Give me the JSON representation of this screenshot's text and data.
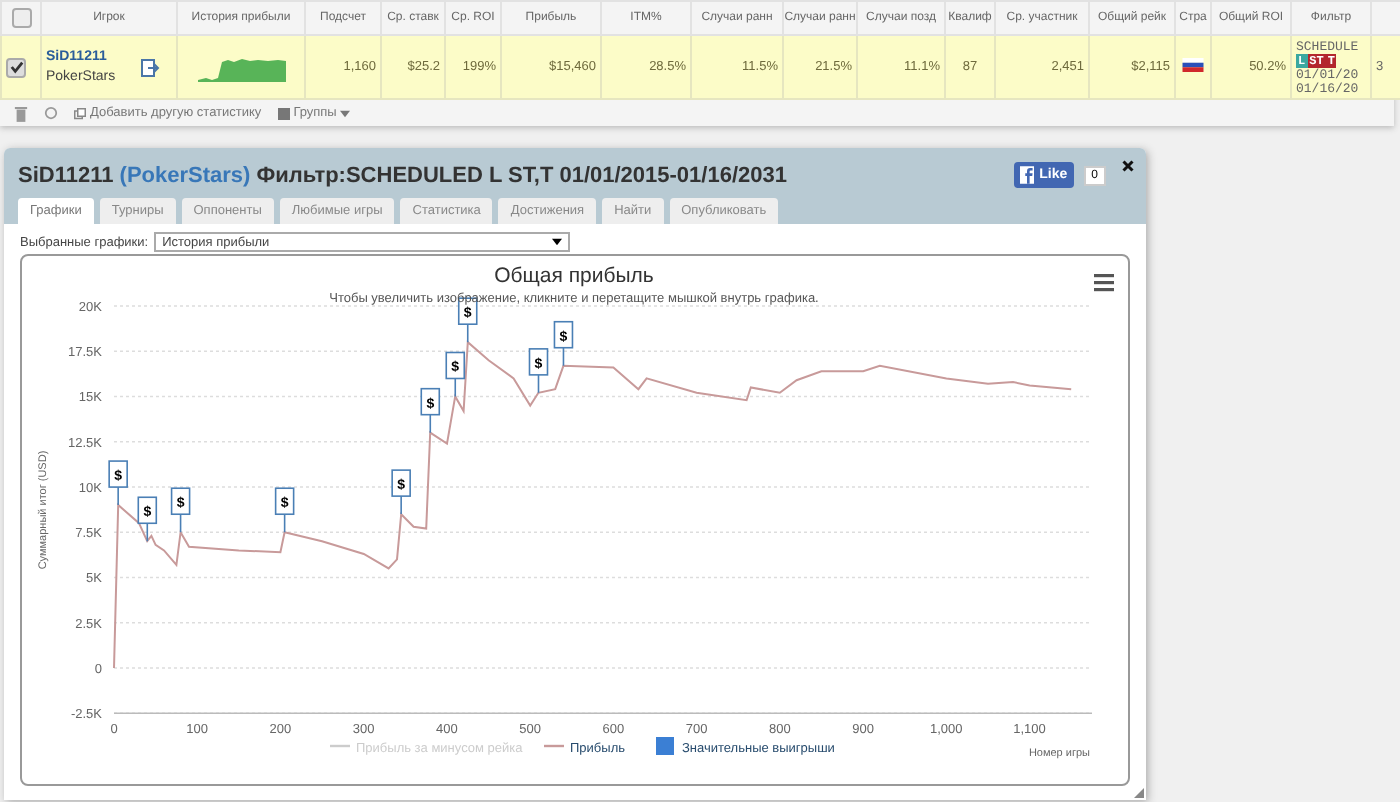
{
  "table": {
    "header_checked": false,
    "columns": [
      "Игрок",
      "История прибыли",
      "Подсчет",
      "Ср. ставк",
      "Ср. ROI",
      "Прибыль",
      "ITM%",
      "Случаи ранн",
      "Случаи ранн",
      "Случаи позд",
      "Квалиф",
      "Ср. участник",
      "Общий рейк",
      "Стра",
      "Общий ROI",
      "Фильтр"
    ],
    "rows": [
      {
        "checked": true,
        "player": "SiD11211",
        "site": "PokerStars",
        "values": [
          "1,160",
          "$25.2",
          "199%",
          "$15,460",
          "28.5%",
          "11.5%",
          "21.5%",
          "11.1%",
          "87",
          "2,451",
          "$2,115"
        ],
        "roi_total": "50.2%",
        "filter": {
          "text": "SCHEDULE",
          "badges": [
            {
              "label": "L",
              "color": "#3aa8a0"
            },
            {
              "label": "ST",
              "color": "#b3262d"
            },
            {
              "label": "T",
              "color": "#b3262d"
            }
          ],
          "dates": [
            "01/01/20",
            "01/16/20"
          ]
        },
        "column_18": "3"
      }
    ]
  },
  "toolbar": {
    "add_stat": "Добавить другую статистику",
    "groups": "Группы"
  },
  "dialog": {
    "player": "SiD11211",
    "site": "(PokerStars)",
    "filter": "Фильтр:SCHEDULED L ST,T 01/01/2015-01/16/2031",
    "like": "Like",
    "like_count": "0",
    "tabs": [
      {
        "label": "Графики",
        "selected": true
      },
      {
        "label": "Турниры",
        "selected": false
      },
      {
        "label": "Оппоненты",
        "selected": false
      },
      {
        "label": "Любимые игры",
        "selected": false
      },
      {
        "label": "Статистика",
        "selected": false
      },
      {
        "label": "Достижения",
        "selected": false
      },
      {
        "label": "Найти",
        "selected": false
      },
      {
        "label": "Опубликовать",
        "selected": false
      }
    ],
    "select_label": "Выбранные графики:",
    "select_value": "История прибыли",
    "chart": {
      "subtitle": "Чтобы увеличить изображение, кликните и перетащите мышкой внутрь графика.",
      "legend": [
        {
          "label": "Прибыль за минусом рейка",
          "kind": "line",
          "color": "#cccccc",
          "hidden": true
        },
        {
          "kind": "series",
          "hidden": false
        },
        {
          "label": "Значительные выигрыши",
          "kind": "square",
          "color": "#3b7fd4",
          "hidden": false
        }
      ],
      "chart_data": {
        "type": "line",
        "title": "Общая прибыль",
        "xlabel": "Номер игры",
        "ylabel": "Суммарный итог (USD)",
        "x": [
          0,
          5,
          30,
          40,
          45,
          50,
          60,
          75,
          80,
          90,
          150,
          200,
          205,
          250,
          300,
          330,
          340,
          345,
          360,
          375,
          380,
          400,
          410,
          420,
          425,
          450,
          480,
          500,
          510,
          530,
          540,
          600,
          630,
          640,
          700,
          760,
          765,
          800,
          820,
          850,
          900,
          920,
          1000,
          1050,
          1080,
          1100,
          1150
        ],
        "series": [
          {
            "name": "Прибыль",
            "color": "#c89a9a",
            "values": [
              0,
              9000,
              8000,
              7000,
              7300,
              6800,
              6500,
              5700,
              7500,
              6700,
              6500,
              6400,
              7500,
              7000,
              6300,
              5500,
              6000,
              8500,
              7800,
              7700,
              13000,
              12400,
              15000,
              14200,
              18000,
              17000,
              16000,
              14500,
              15200,
              15400,
              16700,
              16600,
              15400,
              16000,
              15200,
              14800,
              15500,
              15200,
              15900,
              16400,
              16400,
              16700,
              16000,
              15700,
              15800,
              15600,
              15400
            ]
          }
        ],
        "xlim": [
          0,
          1175
        ],
        "grid": true,
        "ylim": [
          -2500,
          20000
        ],
        "xticks": [
          0,
          100,
          200,
          300,
          400,
          500,
          600,
          700,
          800,
          900,
          {
            "value": 1000,
            "label": "1,000"
          },
          {
            "value": 1100,
            "label": "1,100"
          }
        ],
        "yticks": [
          {
            "value": -2500,
            "label": "-2.5K"
          },
          {
            "value": 0,
            "label": "0"
          },
          {
            "value": 2500,
            "label": "2.5K"
          },
          {
            "value": 5000,
            "label": "5K"
          },
          {
            "value": 7500,
            "label": "7.5K"
          },
          {
            "value": 10000,
            "label": "10K"
          },
          {
            "value": 12500,
            "label": "12.5K"
          },
          {
            "value": 15000,
            "label": "15K"
          },
          {
            "value": 17500,
            "label": "17.5K"
          },
          {
            "value": 20000,
            "label": "20K"
          }
        ],
        "annotations": [
          {
            "x": 5,
            "y": 9000,
            "text": "$"
          },
          {
            "x": 40,
            "y": 7000,
            "text": "$"
          },
          {
            "x": 80,
            "y": 7500,
            "text": "$"
          },
          {
            "x": 205,
            "y": 7500,
            "text": "$"
          },
          {
            "x": 345,
            "y": 8500,
            "text": "$"
          },
          {
            "x": 380,
            "y": 13000,
            "text": "$"
          },
          {
            "x": 410,
            "y": 15000,
            "text": "$"
          },
          {
            "x": 425,
            "y": 18000,
            "text": "$"
          },
          {
            "x": 510,
            "y": 15200,
            "text": "$"
          },
          {
            "x": 540,
            "y": 16700,
            "text": "$"
          }
        ]
      }
    }
  }
}
